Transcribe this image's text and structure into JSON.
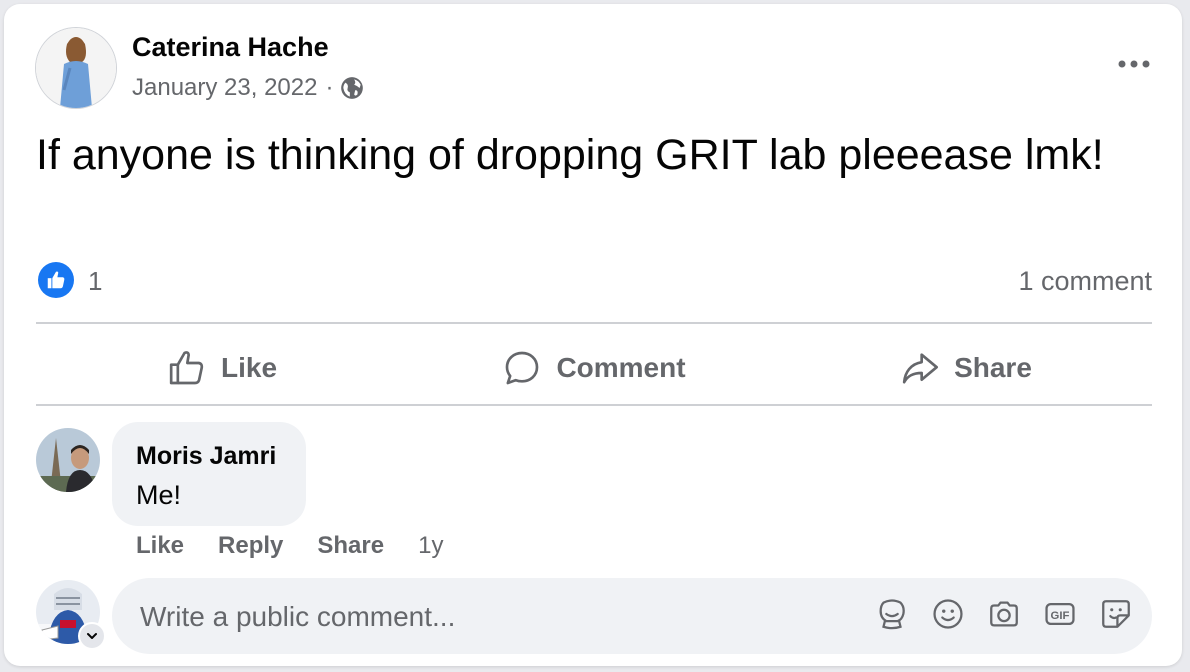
{
  "post": {
    "author_name": "Caterina Hache",
    "date": "January 23, 2022",
    "separator": "·",
    "privacy_icon": "globe-icon",
    "text": "If anyone is thinking of dropping GRIT lab pleeease lmk!",
    "reaction_icon": "like-reaction-icon",
    "reaction_count": "1",
    "comment_count": "1 comment"
  },
  "actions": {
    "like": "Like",
    "comment": "Comment",
    "share": "Share"
  },
  "comment": {
    "author": "Moris Jamri",
    "text": "Me!",
    "like": "Like",
    "reply": "Reply",
    "share": "Share",
    "time": "1y"
  },
  "composer": {
    "placeholder": "Write a public comment...",
    "icons": [
      "avatar-sticker-icon",
      "emoji-icon",
      "camera-icon",
      "gif-icon",
      "sticker-icon"
    ]
  },
  "colors": {
    "accent": "#1877f2",
    "secondary_text": "#65676b",
    "bubble": "#f0f2f5"
  }
}
